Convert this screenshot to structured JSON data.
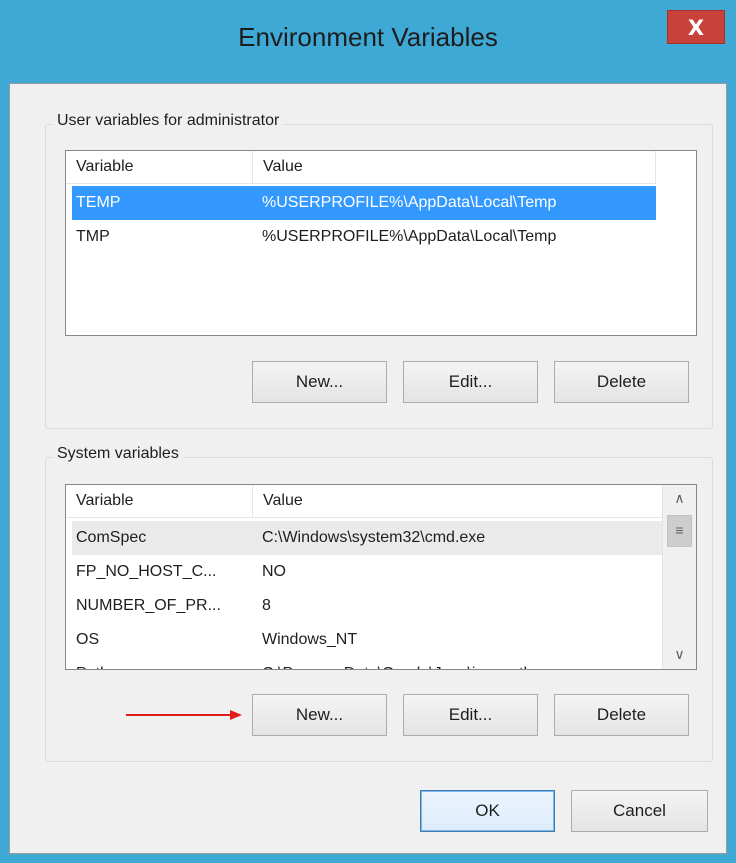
{
  "window": {
    "title": "Environment Variables",
    "close_glyph": "X",
    "close_color": "#c8413a",
    "frame_color": "#3fa9d6"
  },
  "user_vars": {
    "group_label": "User variables for administrator",
    "columns": [
      "Variable",
      "Value"
    ],
    "rows": [
      {
        "variable": "TEMP",
        "value": "%USERPROFILE%\\AppData\\Local\\Temp",
        "selected": true
      },
      {
        "variable": "TMP",
        "value": "%USERPROFILE%\\AppData\\Local\\Temp",
        "selected": false
      }
    ],
    "buttons": {
      "new": "New...",
      "edit": "Edit...",
      "delete": "Delete"
    }
  },
  "system_vars": {
    "group_label": "System variables",
    "columns": [
      "Variable",
      "Value"
    ],
    "rows": [
      {
        "variable": "ComSpec",
        "value": "C:\\Windows\\system32\\cmd.exe",
        "focused": true
      },
      {
        "variable": "FP_NO_HOST_C...",
        "value": "NO"
      },
      {
        "variable": "NUMBER_OF_PR...",
        "value": "8"
      },
      {
        "variable": "OS",
        "value": "Windows_NT"
      },
      {
        "variable": "Path",
        "value": "C:\\ProgramData\\Oracle\\Java\\javapath;"
      }
    ],
    "scrollbar": {
      "up": "∧",
      "thumb": "≡",
      "down": "∨"
    },
    "buttons": {
      "new": "New...",
      "edit": "Edit...",
      "delete": "Delete"
    }
  },
  "dialog_buttons": {
    "ok": "OK",
    "cancel": "Cancel"
  },
  "annotation": {
    "arrow_color": "#e21b1b"
  },
  "selection_color": "#3399ff"
}
